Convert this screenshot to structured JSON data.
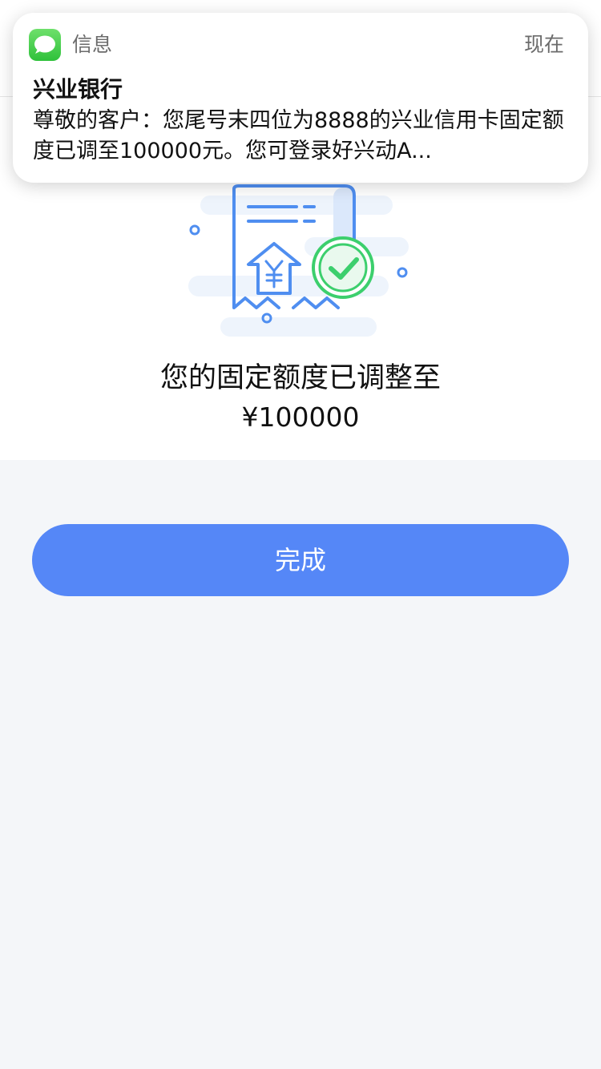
{
  "notification": {
    "app_name": "信息",
    "time": "现在",
    "sender": "兴业银行",
    "message": "尊敬的客户：您尾号末四位为8888的兴业信用卡固定额度已调至100000元。您可登录好兴动A..."
  },
  "result": {
    "title": "您的固定额度已调整至",
    "amount": "¥100000",
    "illustration_icons": [
      "receipt-icon",
      "yuan-upgrade-icon",
      "check-circle-icon"
    ]
  },
  "actions": {
    "done_label": "完成"
  },
  "colors": {
    "primary": "#5587f7",
    "success": "#3ccf6d",
    "background": "#f4f6f9"
  }
}
